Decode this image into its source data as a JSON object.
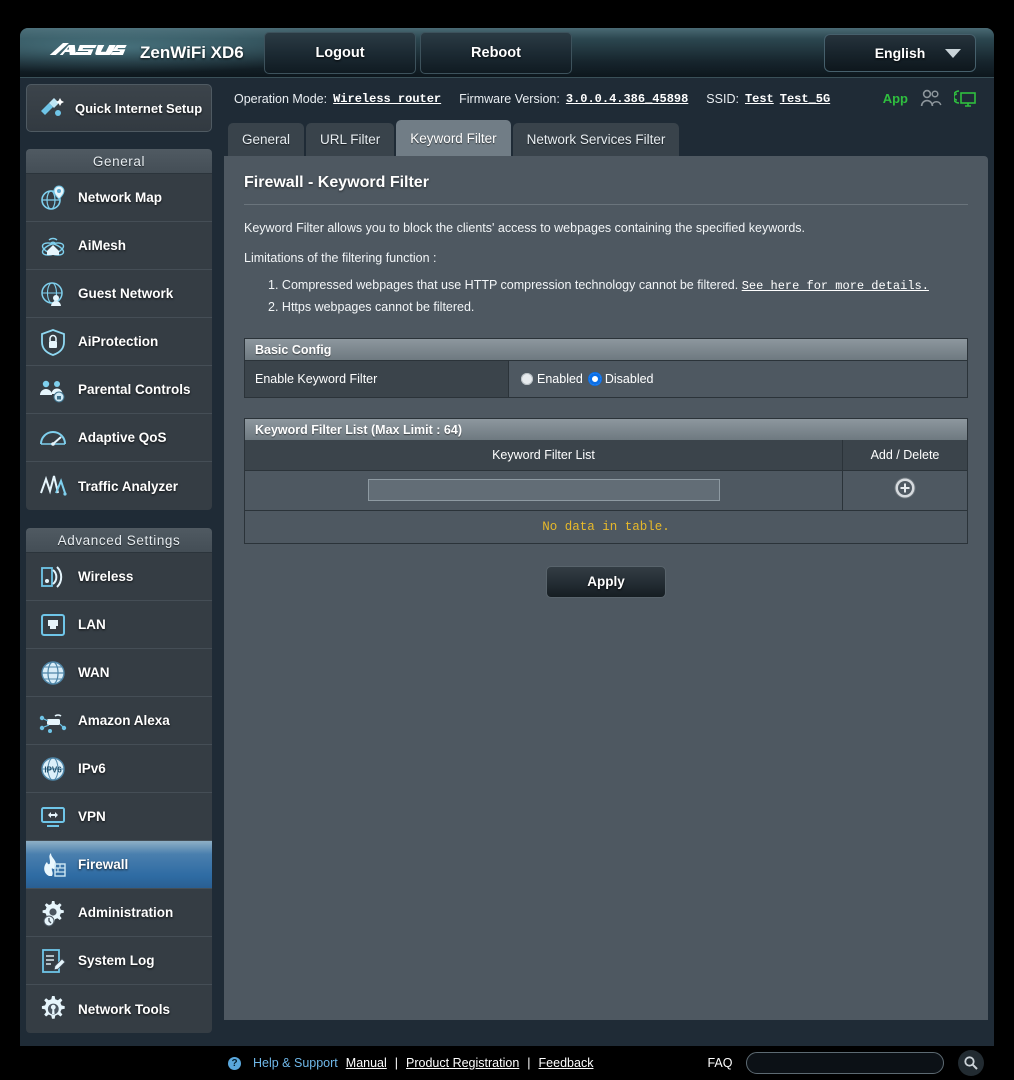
{
  "header": {
    "brand": "/ISUS",
    "model": "ZenWiFi XD6",
    "logout_label": "Logout",
    "reboot_label": "Reboot",
    "language": "English"
  },
  "statusbar": {
    "operation_mode_label": "Operation Mode:",
    "operation_mode_value": "Wireless router",
    "firmware_label": "Firmware Version:",
    "firmware_value": "3.0.0.4.386_45898",
    "ssid_label": "SSID:",
    "ssid_value_1": "Test",
    "ssid_value_2": "Test_5G",
    "app_label": "App",
    "clients_icon": "clients-icon",
    "network_icon": "network-monitor-icon"
  },
  "sidebar": {
    "quick_internet_setup": "Quick Internet Setup",
    "quick_internet_setup_icon": "quick-setup-icon",
    "groups": [
      {
        "title": "General",
        "items": [
          {
            "label": "Network Map",
            "icon": "network-map-icon",
            "active": false
          },
          {
            "label": "AiMesh",
            "icon": "aimesh-icon",
            "active": false
          },
          {
            "label": "Guest Network",
            "icon": "guest-network-icon",
            "active": false
          },
          {
            "label": "AiProtection",
            "icon": "shield-lock-icon",
            "active": false
          },
          {
            "label": "Parental Controls",
            "icon": "parental-controls-icon",
            "active": false
          },
          {
            "label": "Adaptive QoS",
            "icon": "gauge-icon",
            "active": false
          },
          {
            "label": "Traffic Analyzer",
            "icon": "traffic-analyzer-icon",
            "active": false
          }
        ]
      },
      {
        "title": "Advanced Settings",
        "items": [
          {
            "label": "Wireless",
            "icon": "wireless-icon",
            "active": false
          },
          {
            "label": "LAN",
            "icon": "lan-port-icon",
            "active": false
          },
          {
            "label": "WAN",
            "icon": "globe-icon",
            "active": false
          },
          {
            "label": "Amazon Alexa",
            "icon": "alexa-icon",
            "active": false
          },
          {
            "label": "IPv6",
            "icon": "ipv6-globe-icon",
            "active": false
          },
          {
            "label": "VPN",
            "icon": "vpn-icon",
            "active": false
          },
          {
            "label": "Firewall",
            "icon": "firewall-flame-icon",
            "active": true
          },
          {
            "label": "Administration",
            "icon": "administration-gear-icon",
            "active": false
          },
          {
            "label": "System Log",
            "icon": "system-log-icon",
            "active": false
          },
          {
            "label": "Network Tools",
            "icon": "network-tools-icon",
            "active": false
          }
        ]
      }
    ]
  },
  "tabs": [
    {
      "label": "General",
      "active": false
    },
    {
      "label": "URL Filter",
      "active": false
    },
    {
      "label": "Keyword Filter",
      "active": true
    },
    {
      "label": "Network Services Filter",
      "active": false
    }
  ],
  "main": {
    "page_title": "Firewall - Keyword Filter",
    "description": "Keyword Filter allows you to block the clients' access to webpages containing the specified keywords.",
    "limitations_title": "Limitations of the filtering function :",
    "limitations": [
      {
        "num": "1.",
        "text": "Compressed webpages that use HTTP compression technology cannot be filtered.",
        "link": "See here for more details."
      },
      {
        "num": "2.",
        "text": "Https webpages cannot be filtered.",
        "link": ""
      }
    ],
    "basic_config_title": "Basic Config",
    "enable_label": "Enable Keyword Filter",
    "radio_enabled": "Enabled",
    "radio_disabled": "Disabled",
    "selected_radio": "Disabled",
    "list_title": "Keyword Filter List (Max Limit : 64)",
    "col_keyword": "Keyword Filter List",
    "col_action": "Add / Delete",
    "keyword_input_value": "",
    "keyword_input_placeholder": "",
    "add_icon": "add-circle-icon",
    "no_data": "No data in table.",
    "apply_label": "Apply"
  },
  "footer": {
    "help_support": "Help & Support",
    "manual": "Manual",
    "product_registration": "Product Registration",
    "feedback": "Feedback",
    "pipe": "|",
    "faq_label": "FAQ",
    "faq_value": "",
    "faq_placeholder": "",
    "search_icon": "search-icon"
  },
  "colors": {
    "accent_blue": "#2e6ba3",
    "panel": "#4e5861",
    "sidebar": "#353d44",
    "warning_yellow": "#e7b92a",
    "green": "#2fbf3f",
    "radio_selected": "#0a6fe8"
  }
}
